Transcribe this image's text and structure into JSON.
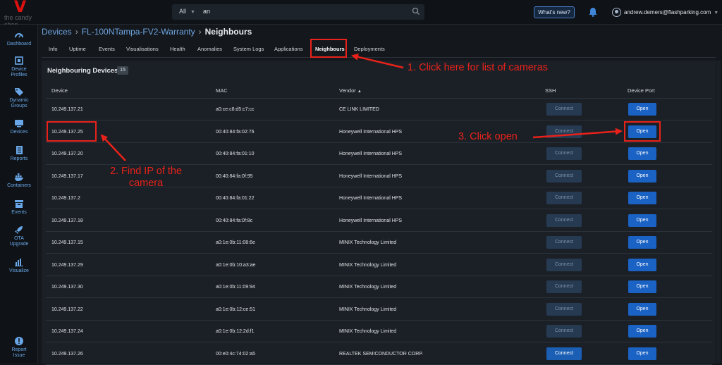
{
  "logo": {
    "mark": "V",
    "text": "the candy shop"
  },
  "search": {
    "filter_label": "All",
    "query": "an"
  },
  "header": {
    "whats_new_label": "What's new?",
    "user_email": "andrew.demers@flashparking.com"
  },
  "sidebar": {
    "items": [
      {
        "label": "Dashboard",
        "icon": "dashboard-icon"
      },
      {
        "label": "Device Profiles",
        "icon": "device-profiles-icon"
      },
      {
        "label": "Dynamic Groups",
        "icon": "tags-icon"
      },
      {
        "label": "Devices",
        "icon": "devices-icon"
      },
      {
        "label": "Reports",
        "icon": "reports-icon"
      },
      {
        "label": "Containers",
        "icon": "docker-icon"
      },
      {
        "label": "Events",
        "icon": "events-icon"
      },
      {
        "label": "OTA Upgrade",
        "icon": "rocket-icon"
      },
      {
        "label": "Visualize",
        "icon": "bar-chart-icon"
      },
      {
        "label": "Report Issue",
        "icon": "alert-icon"
      }
    ]
  },
  "breadcrumb": {
    "root": "Devices",
    "device": "FL-100NTampa-FV2-Warranty",
    "current": "Neighbours"
  },
  "tabs": [
    "Info",
    "Uptime",
    "Events",
    "Visualisations",
    "Health",
    "Anomalies",
    "System Logs",
    "Applications",
    "Neighbours",
    "Deployments"
  ],
  "active_tab": "Neighbours",
  "panel": {
    "title": "Neighbouring Devices",
    "count": "15"
  },
  "table": {
    "headers": {
      "device": "Device",
      "mac": "MAC",
      "vendor": "Vendor",
      "vendor_sort": "▲",
      "ssh": "SSH",
      "port": "Device Port"
    },
    "connect_label": "Connect",
    "open_label": "Open",
    "rows": [
      {
        "device": "10.249.137.21",
        "mac": "a0:ce:c8:d5:c7:cc",
        "vendor": "CE LINK LIMITED",
        "connect_enabled": false
      },
      {
        "device": "10.249.137.25",
        "mac": "00:40:84:fa:02:76",
        "vendor": "Honeywell International HPS",
        "connect_enabled": false
      },
      {
        "device": "10.249.137.20",
        "mac": "00:40:84:fa:01:10",
        "vendor": "Honeywell International HPS",
        "connect_enabled": false
      },
      {
        "device": "10.249.137.17",
        "mac": "00:40:84:fa:0f:95",
        "vendor": "Honeywell International HPS",
        "connect_enabled": false
      },
      {
        "device": "10.249.137.2",
        "mac": "00:40:84:fa:01:22",
        "vendor": "Honeywell International HPS",
        "connect_enabled": false
      },
      {
        "device": "10.249.137.18",
        "mac": "00:40:84:fa:0f:8c",
        "vendor": "Honeywell International HPS",
        "connect_enabled": false
      },
      {
        "device": "10.249.137.15",
        "mac": "a0:1e:0b:11:08:6e",
        "vendor": "MINIX Technology Limited",
        "connect_enabled": false
      },
      {
        "device": "10.249.137.29",
        "mac": "a0:1e:0b:10:a3:ae",
        "vendor": "MINIX Technology Limited",
        "connect_enabled": false
      },
      {
        "device": "10.249.137.30",
        "mac": "a0:1e:0b:11:09:94",
        "vendor": "MINIX Technology Limited",
        "connect_enabled": false
      },
      {
        "device": "10.249.137.22",
        "mac": "a0:1e:0b:12:ce:51",
        "vendor": "MINIX Technology Limited",
        "connect_enabled": false
      },
      {
        "device": "10.249.137.24",
        "mac": "a0:1e:0b:12:2d:f1",
        "vendor": "MINIX Technology Limited",
        "connect_enabled": false
      },
      {
        "device": "10.249.137.26",
        "mac": "00:e0:4c:74:02:a5",
        "vendor": "REALTEK SEMICONDUCTOR CORP.",
        "connect_enabled": true
      }
    ]
  },
  "annotations": {
    "step1": "1. Click here for list of cameras",
    "step2_line1": "2. Find IP of the",
    "step2_line2": "camera",
    "step3": "3. Click open",
    "color": "#e8221a"
  },
  "colors": {
    "accent": "#1a62c4",
    "link": "#6ea3df",
    "background": "#14181d"
  }
}
